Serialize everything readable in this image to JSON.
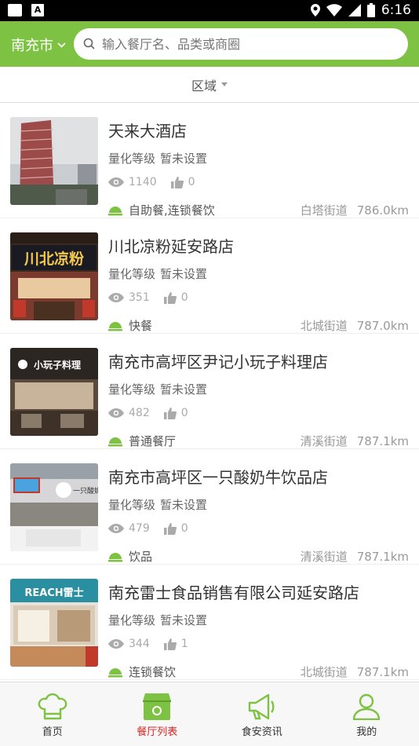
{
  "status": {
    "time": "6:16"
  },
  "header": {
    "city": "南充市",
    "search_placeholder": "输入餐厅名、品类或商圈"
  },
  "filter": {
    "label": "区域"
  },
  "colors": {
    "brand": "#7dc243",
    "active_tab": "#e02020"
  },
  "restaurants": [
    {
      "name": "天来大酒店",
      "grade_label": "量化等级",
      "grade_value": "暂未设置",
      "views": "1140",
      "likes": "0",
      "category": "自助餐,连锁餐饮",
      "street": "白塔街道",
      "distance": "786.0km"
    },
    {
      "name": "川北凉粉延安路店",
      "grade_label": "量化等级",
      "grade_value": "暂未设置",
      "views": "351",
      "likes": "0",
      "category": "快餐",
      "street": "北城街道",
      "distance": "787.0km"
    },
    {
      "name": "南充市高坪区尹记小玩子料理店",
      "grade_label": "量化等级",
      "grade_value": "暂未设置",
      "views": "482",
      "likes": "0",
      "category": "普通餐厅",
      "street": "清溪街道",
      "distance": "787.1km"
    },
    {
      "name": "南充市高坪区一只酸奶牛饮品店",
      "grade_label": "量化等级",
      "grade_value": "暂未设置",
      "views": "479",
      "likes": "0",
      "category": "饮品",
      "street": "清溪街道",
      "distance": "787.1km"
    },
    {
      "name": "南充雷士食品销售有限公司延安路店",
      "grade_label": "量化等级",
      "grade_value": "暂未设置",
      "views": "344",
      "likes": "1",
      "category": "连锁餐饮",
      "street": "北城街道",
      "distance": "787.1km"
    }
  ],
  "thumb_texts": {
    "t2": "川北凉粉",
    "t3": "小玩子料理",
    "t4": "一只酸奶",
    "t5": "REACH雷士"
  },
  "tabs": [
    {
      "label": "首页",
      "icon": "chef-hat-icon"
    },
    {
      "label": "餐厅列表",
      "icon": "store-icon"
    },
    {
      "label": "食安资讯",
      "icon": "megaphone-icon"
    },
    {
      "label": "我的",
      "icon": "user-icon"
    }
  ]
}
